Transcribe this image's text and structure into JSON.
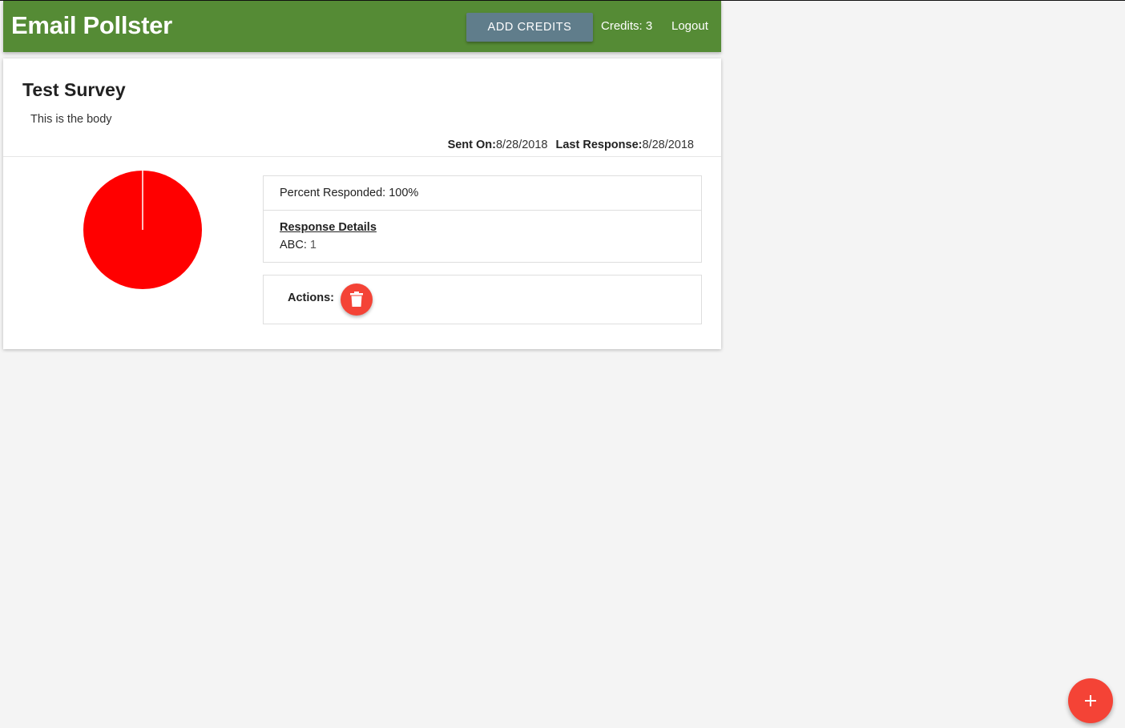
{
  "navbar": {
    "brand": "Email Pollster",
    "add_credits_label": "ADD CREDITS",
    "credits_text": "Credits: 3",
    "logout_label": "Logout",
    "background_color": "#558b35",
    "button_color": "#607d8b"
  },
  "survey": {
    "title": "Test Survey",
    "body": "This is the body",
    "sent_on_label": "Sent On:",
    "sent_on_value": "8/28/2018",
    "last_response_label": "Last Response:",
    "last_response_value": "8/28/2018",
    "percent_responded_text": "Percent Responded: 100%",
    "response_details_title": "Response Details",
    "response_details": [
      {
        "label": "ABC",
        "value": "1"
      }
    ],
    "actions_label": "Actions:",
    "delete_icon": "trash-icon",
    "chart_data": {
      "type": "pie",
      "categories": [
        "ABC"
      ],
      "values": [
        1
      ],
      "colors": [
        "#ff0000"
      ]
    }
  },
  "fab": {
    "icon": "plus-icon",
    "color": "#f44336"
  }
}
